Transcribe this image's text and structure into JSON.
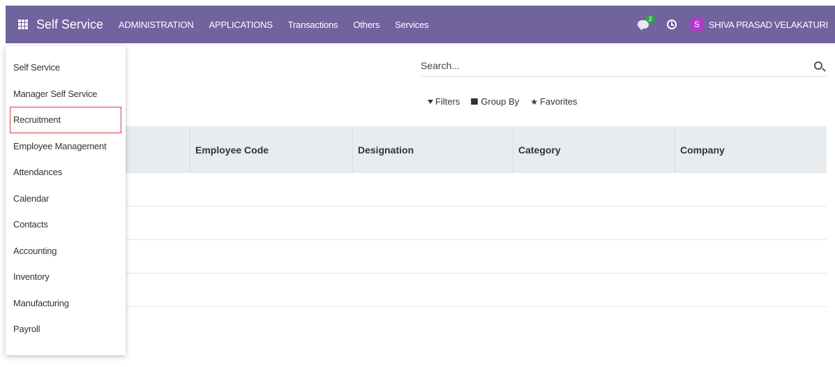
{
  "navbar": {
    "brand": "Self Service",
    "menus": [
      "ADMINISTRATION",
      "APPLICATIONS",
      "Transactions",
      "Others",
      "Services"
    ],
    "chat_badge": "2",
    "avatar_letter": "S",
    "username": "SHIVA PRASAD VELAKATURI",
    "bg_color": "#71639e",
    "avatar_color": "#b439c9",
    "badge_color": "#28a745"
  },
  "search": {
    "placeholder": "Search..."
  },
  "filters": {
    "filters_label": "Filters",
    "group_by_label": "Group By",
    "favorites_label": "Favorites"
  },
  "table": {
    "columns": [
      "Employee Code",
      "Designation",
      "Category",
      "Company"
    ]
  },
  "dropdown": {
    "items": [
      "Self Service",
      "Manager Self Service",
      "Recruitment",
      "Employee Management",
      "Attendances",
      "Calendar",
      "Contacts",
      "Accounting",
      "Inventory",
      "Manufacturing",
      "Payroll"
    ],
    "highlight_color": "#e03b3b"
  }
}
